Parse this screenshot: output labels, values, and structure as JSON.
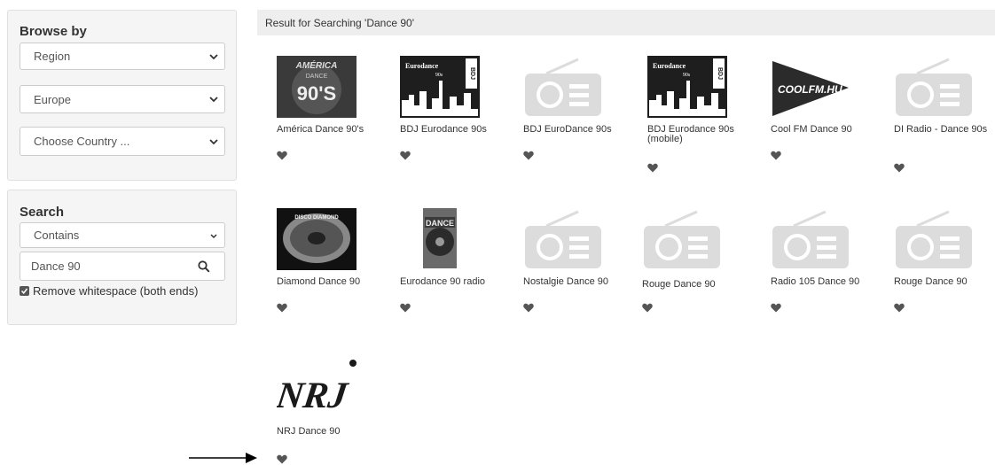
{
  "sidebar": {
    "browse": {
      "title": "Browse by",
      "region_select": "Region",
      "continent_select": "Europe",
      "country_select": "Choose Country ..."
    },
    "search": {
      "title": "Search",
      "mode_select": "Contains",
      "query": "Dance 90",
      "whitespace_label": "Remove whitespace (both ends)",
      "whitespace_checked": true
    }
  },
  "results": {
    "header": "Result for Searching 'Dance 90'",
    "stations": [
      {
        "name": "América Dance 90's",
        "logo": "america-dance-logo"
      },
      {
        "name": "BDJ Eurodance 90s",
        "logo": "eurodance-logo"
      },
      {
        "name": "BDJ EuroDance 90s",
        "logo": "radio-icon"
      },
      {
        "name": "BDJ Eurodance 90s (mobile)",
        "logo": "eurodance-logo"
      },
      {
        "name": "Cool FM Dance 90",
        "logo": "coolfm-logo"
      },
      {
        "name": "DI Radio - Dance 90s",
        "logo": "radio-icon"
      },
      {
        "name": "Diamond Dance 90",
        "logo": "diamond-logo"
      },
      {
        "name": "Eurodance 90 radio",
        "logo": "eurodance90-logo"
      },
      {
        "name": "Nostalgie Dance 90",
        "logo": "radio-icon"
      },
      {
        "name": "Rouge Dance 90",
        "logo": "radio-icon"
      },
      {
        "name": "Radio 105 Dance 90",
        "logo": "radio-icon"
      },
      {
        "name": "Rouge Dance 90",
        "logo": "radio-icon"
      },
      {
        "name": "NRJ Dance 90",
        "logo": "nrj-logo"
      }
    ]
  },
  "logo_text": {
    "america": [
      "AMÉRICA",
      "DANCE",
      "90'S"
    ],
    "eurodance": [
      "Eurodance",
      "90s",
      "BDJ"
    ],
    "coolfm": "COOLFM.HU",
    "diamond": "DISCO DIAMOND",
    "eurodance90": "DANCE",
    "nrj": "NRJ"
  },
  "icons": {
    "favorite": "heart-icon",
    "dropdown": "chevron-down-icon",
    "search": "search-icon",
    "annotation": "arrow-right-icon"
  },
  "colors": {
    "heart": "#555555",
    "placeholder_radio": "#d9d9d9",
    "header_bg": "#eeeeee"
  }
}
